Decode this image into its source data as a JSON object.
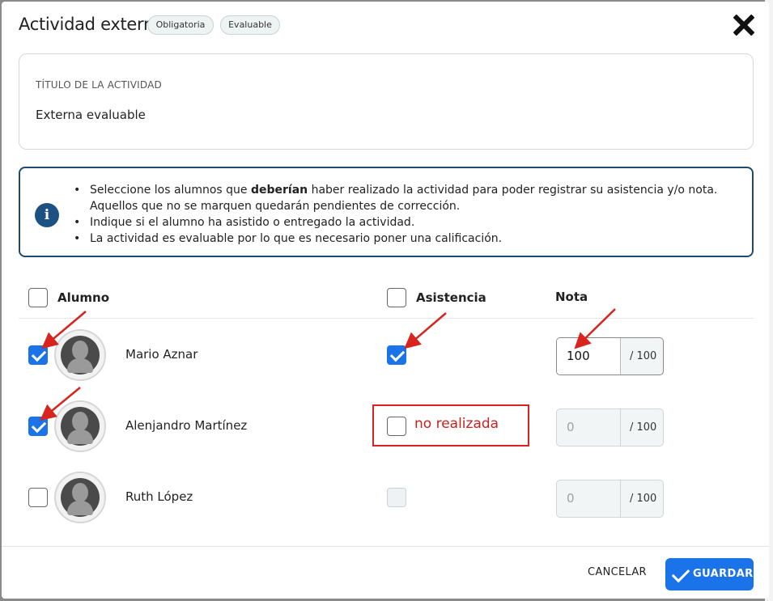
{
  "header": {
    "title": "Actividad externa",
    "chips": [
      "Obligatoria",
      "Evaluable"
    ]
  },
  "activity": {
    "title_label": "TÍTULO DE LA ACTIVIDAD",
    "title_value": "Externa evaluable"
  },
  "info": {
    "line1_a": "Seleccione los alumnos que ",
    "line1_bold": "deberían",
    "line1_b": " haber realizado la actividad para poder registrar su asistencia y/o nota. Aquellos que no se marquen quedarán pendientes de corrección.",
    "line2": "Indique si el alumno ha asistido o entregado la actividad.",
    "line3": "La actividad es evaluable por lo que es necesario poner una calificación."
  },
  "table": {
    "col_student": "Alumno",
    "col_attendance": "Asistencia",
    "col_grade": "Nota",
    "rows": [
      {
        "name": "Mario Aznar",
        "selected": true,
        "attended": true,
        "grade": "100",
        "max": "/ 100"
      },
      {
        "name": "Alenjandro Martínez",
        "selected": true,
        "attended": false,
        "grade": "0",
        "max": "/ 100"
      },
      {
        "name": "Ruth López",
        "selected": false,
        "attended": false,
        "grade": "0",
        "max": "/ 100"
      }
    ]
  },
  "annotation": {
    "text": "no realizada"
  },
  "footer": {
    "cancel_label": "CANCELAR",
    "save_label": "GUARDAR"
  },
  "colors": {
    "accent": "#1a73e8",
    "info_border": "#1c4a73",
    "annotation_red": "#d9231e"
  }
}
